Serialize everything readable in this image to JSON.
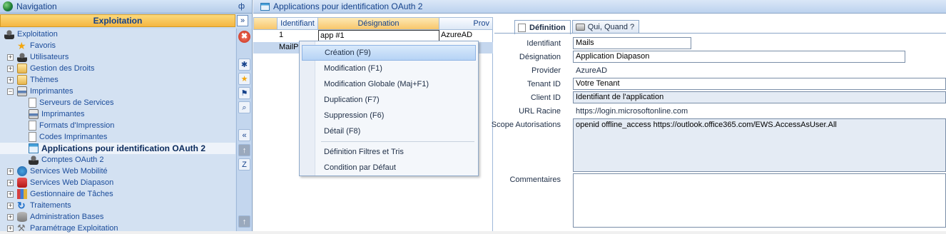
{
  "nav": {
    "title": "Navigation",
    "pin": "ф",
    "section": "Exploitation",
    "collapse": "»",
    "tree": [
      {
        "label": "Exploitation",
        "icon": "user-icon",
        "level": 0,
        "expander": ""
      },
      {
        "label": "Favoris",
        "icon": "star-icon",
        "level": 1,
        "expander": ""
      },
      {
        "label": "Utilisateurs",
        "icon": "users-icon",
        "level": 1,
        "expander": "+"
      },
      {
        "label": "Gestion des Droits",
        "icon": "rights-icon",
        "level": 1,
        "expander": "+"
      },
      {
        "label": "Thèmes",
        "icon": "themes-icon",
        "level": 1,
        "expander": "+"
      },
      {
        "label": "Imprimantes",
        "icon": "printer-icon",
        "level": 1,
        "expander": "−"
      },
      {
        "label": "Serveurs de Services",
        "icon": "document-icon",
        "level": 2,
        "expander": ""
      },
      {
        "label": "Imprimantes",
        "icon": "printer-icon",
        "level": 2,
        "expander": ""
      },
      {
        "label": "Formats d'Impression",
        "icon": "document-icon",
        "level": 2,
        "expander": ""
      },
      {
        "label": "Codes Imprimantes",
        "icon": "document-icon",
        "level": 2,
        "expander": ""
      },
      {
        "label": "Applications pour identification OAuth 2",
        "icon": "app-window-icon",
        "level": 2,
        "expander": "",
        "selected": true
      },
      {
        "label": "Comptes OAuth 2",
        "icon": "account-icon",
        "level": 2,
        "expander": ""
      },
      {
        "label": "Services Web Mobilité",
        "icon": "web-mobile-icon",
        "level": 1,
        "expander": "+"
      },
      {
        "label": "Services Web Diapason",
        "icon": "web-diapason-icon",
        "level": 1,
        "expander": "+"
      },
      {
        "label": "Gestionnaire de Tâches",
        "icon": "tasks-icon",
        "level": 1,
        "expander": "+"
      },
      {
        "label": "Traitements",
        "icon": "refresh-icon",
        "level": 1,
        "expander": "+"
      },
      {
        "label": "Administration  Bases",
        "icon": "database-icon",
        "level": 1,
        "expander": "+"
      },
      {
        "label": "Paramétrage Exploitation",
        "icon": "wrench-icon",
        "level": 1,
        "expander": "+"
      }
    ],
    "toolbar": {
      "close": "✖",
      "tool1": "✱",
      "fav": "★",
      "flag": "⚑",
      "search": "⌕",
      "collapse_left": "«",
      "up": "↑",
      "zoom": "Z",
      "bottom_up": "↑"
    }
  },
  "main": {
    "title": "Applications pour identification OAuth 2",
    "grid": {
      "columns": [
        "Identifiant",
        "Désignation",
        "Prov"
      ],
      "rows": [
        [
          "1",
          "app #1",
          "AzureAD"
        ],
        [
          "MailP",
          "",
          ""
        ]
      ]
    },
    "context_menu": {
      "items": [
        "Création (F9)",
        "Modification (F1)",
        "Modification Globale (Maj+F1)",
        "Duplication (F7)",
        "Suppression (F6)",
        "Détail (F8)",
        "Définition Filtres et Tris",
        "Condition par Défaut"
      ]
    },
    "detail": {
      "tabs": [
        "Définition",
        "Qui, Quand ?"
      ],
      "fields": {
        "identifiant_label": "Identifiant",
        "identifiant": "Mails",
        "designation_label": "Désignation",
        "designation": "Application Diapason",
        "provider_label": "Provider",
        "provider": "AzureAD",
        "tenant_label": "Tenant ID",
        "tenant": "Votre Tenant",
        "client_label": "Client ID",
        "client": "Identifiant de l'application",
        "url_label": "URL Racine",
        "url": "https://login.microsoftonline.com",
        "scope_label": "Scope Autorisations",
        "scope": "openid offline_access https://outlook.office365.com/EWS.AccessAsUser.All",
        "comments_label": "Commentaires",
        "comments": ""
      }
    }
  },
  "colors": {
    "nav_bg": "#c9dbf0",
    "section_bg": "#f5b642",
    "menu_highlight": "#b6d3f5"
  }
}
